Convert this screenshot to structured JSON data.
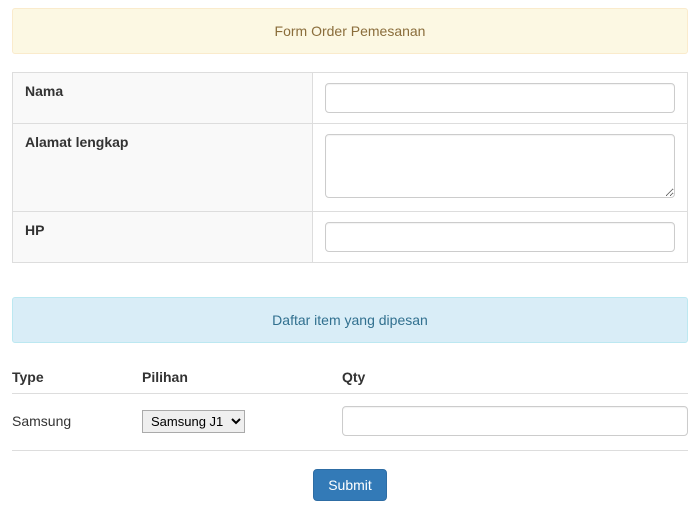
{
  "header": {
    "form_title": "Form Order Pemesanan",
    "items_title": "Daftar item yang dipesan"
  },
  "form": {
    "nama": {
      "label": "Nama",
      "value": ""
    },
    "alamat": {
      "label": "Alamat lengkap",
      "value": ""
    },
    "hp": {
      "label": "HP",
      "value": ""
    }
  },
  "items": {
    "cols": {
      "type": "Type",
      "pilihan": "Pilihan",
      "qty": "Qty"
    },
    "row": {
      "type": "Samsung",
      "pilihan_selected": "Samsung J1",
      "qty": ""
    }
  },
  "actions": {
    "submit": "Submit"
  }
}
